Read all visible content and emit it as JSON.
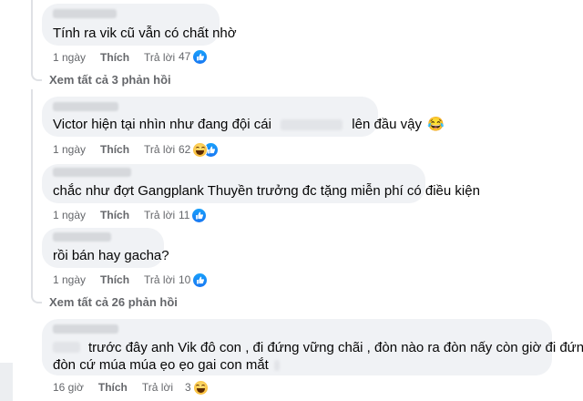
{
  "comments": [
    {
      "text": "Tính ra vik cũ vẫn có chất nhờ",
      "time": "1 ngày",
      "like_label": "Thích",
      "reply_label": "Trả lời",
      "reaction_count": "47",
      "reaction_icon": "like-icon"
    },
    {
      "text_before": "Victor hiện tại nhìn như đang đội cái",
      "text_after": "lên đầu vậy",
      "emoji": "😂",
      "time": "1 ngày",
      "like_label": "Thích",
      "reply_label": "Trả lời",
      "reaction_count": "62",
      "reaction_icon": "haha-and-like-icons"
    },
    {
      "text": "chắc như đợt Gangplank Thuyền trưởng đc tặng miễn phí có điều kiện",
      "time": "1 ngày",
      "like_label": "Thích",
      "reply_label": "Trả lời",
      "reaction_count": "11",
      "reaction_icon": "like-icon"
    },
    {
      "text": "rồi bán hay gacha?",
      "time": "1 ngày",
      "like_label": "Thích",
      "reply_label": "Trả lời",
      "reaction_count": "10",
      "reaction_icon": "like-icon"
    },
    {
      "line1": "trước đây anh Vik đô con , đi đứng vững chãi , đòn nào ra đòn nấy còn giờ đi đứng ra",
      "line2": "đòn cứ múa múa ẹo ẹo gai con mắt",
      "time": "16 giờ",
      "like_label": "Thích",
      "reply_label": "Trả lời",
      "reaction_count": "3",
      "reaction_icon": "haha-icon"
    }
  ],
  "see_all": [
    {
      "label": "Xem tất cả 3 phản hồi"
    },
    {
      "label": "Xem tất cả 26 phản hồi"
    }
  ],
  "colors": {
    "bubble": "#f0f2f5",
    "meta_text": "#65676b",
    "like_blue": "#1877f2",
    "haha_yellow": "#f7b125"
  }
}
